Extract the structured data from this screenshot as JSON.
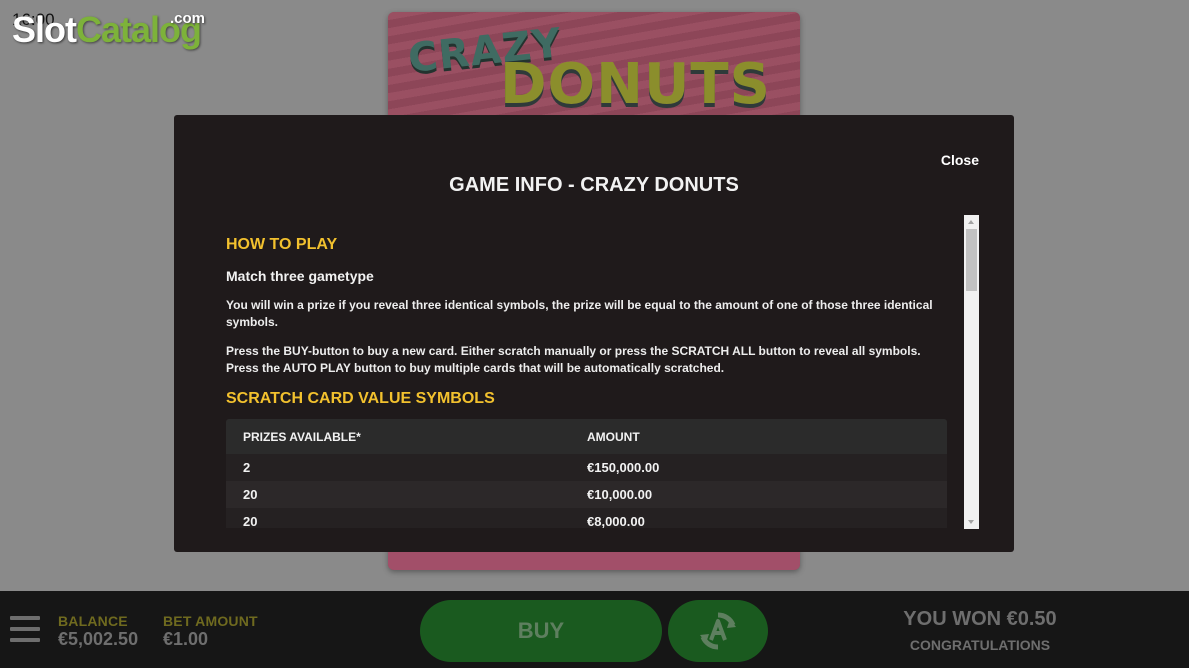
{
  "status_bar": {
    "time": "16:00"
  },
  "brand": {
    "slot": "Slot",
    "catalog": "Catalog",
    "com": ".com"
  },
  "game": {
    "logo_line1": "CRAZY",
    "logo_line2": "DONUTS"
  },
  "bottom_bar": {
    "balance_label": "BALANCE",
    "balance_value": "€5,002.50",
    "bet_label": "BET AMOUNT",
    "bet_value": "€1.00",
    "buy_label": "BUY",
    "won_text": "YOU WON €0.50",
    "congrats_text": "CONGRATULATIONS",
    "icons": {
      "menu": "menu-icon",
      "autoplay": "autoplay-icon"
    }
  },
  "modal": {
    "close_label": "Close",
    "title": "GAME INFO - CRAZY DONUTS",
    "how_to_play_heading": "HOW TO PLAY",
    "gametype": "Match three gametype",
    "para1": "You will win a prize if you reveal three identical symbols, the prize will be equal to the amount of one of those three identical symbols.",
    "para2": "Press the BUY-button to buy a new card. Either scratch manually or press the SCRATCH ALL button to reveal all symbols. Press the AUTO PLAY button to buy multiple cards that will be automatically scratched.",
    "value_symbols_heading": "SCRATCH CARD VALUE SYMBOLS",
    "table": {
      "headers": [
        "PRIZES AVAILABLE*",
        "AMOUNT"
      ],
      "rows": [
        [
          "2",
          "€150,000.00"
        ],
        [
          "20",
          "€10,000.00"
        ],
        [
          "20",
          "€8,000.00"
        ]
      ]
    }
  },
  "colors": {
    "accent_yellow": "#f2c12e",
    "modal_bg": "#1f1a1b",
    "buy_green": "#1a5a1f",
    "brand_green": "#7db23a"
  }
}
